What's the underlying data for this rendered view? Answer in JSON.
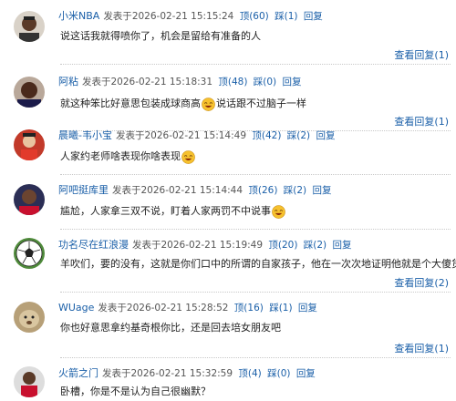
{
  "labels": {
    "posted_prefix": "发表于",
    "ding": "顶",
    "cai": "踩",
    "reply": "回复"
  },
  "comments": [
    {
      "user": "小米NBA",
      "time": "2026-02-21 15:15:24",
      "ding": "(60)",
      "cai": "(1)",
      "text": "说这话我就得喷你了，机会是留给有准备的人",
      "text_after": "",
      "emoji": "",
      "view_replies": "查看回复(1)",
      "avatar_icon": "player-photo-icon"
    },
    {
      "user": "阿粘",
      "time": "2026-02-21 15:18:31",
      "ding": "(48)",
      "cai": "(0)",
      "text": "就这种笨比好意思包装成球商高",
      "text_after": "说话跟不过脑子一样",
      "emoji": "laughing-face-icon",
      "view_replies": "查看回复(1)",
      "avatar_icon": "player-photo-icon"
    },
    {
      "user": "晨曦-韦小宝",
      "time": "2026-02-21 15:14:49",
      "ding": "(42)",
      "cai": "(2)",
      "text": "人家约老师啥表现你啥表现",
      "text_after": "",
      "emoji": "laughing-face-icon",
      "view_replies": "",
      "avatar_icon": "player-photo-icon"
    },
    {
      "user": "阿吧挺库里",
      "time": "2026-02-21 15:14:44",
      "ding": "(26)",
      "cai": "(2)",
      "text": "尴尬，人家拿三双不说，盯着人家两罚不中说事",
      "text_after": "",
      "emoji": "laughing-face-icon",
      "view_replies": "",
      "avatar_icon": "player-photo-icon"
    },
    {
      "user": "功名尽在红浪漫",
      "time": "2026-02-21 15:19:49",
      "ding": "(20)",
      "cai": "(2)",
      "text": "羊吹们，要的没有，这就是你们口中的所谓的自家孩子，他在一次次地证明他就是个大傻货",
      "text_after": "",
      "emoji": "",
      "view_replies": "查看回复(2)",
      "avatar_icon": "soccer-ball-icon"
    },
    {
      "user": "WUage",
      "time": "2026-02-21 15:28:52",
      "ding": "(16)",
      "cai": "(1)",
      "text": "你也好意思拿约基奇根你比，还是回去培女朋友吧",
      "text_after": "",
      "emoji": "",
      "view_replies": "查看回复(1)",
      "avatar_icon": "animal-photo-icon"
    },
    {
      "user": "火箭之门",
      "time": "2026-02-21 15:32:59",
      "ding": "(4)",
      "cai": "(0)",
      "text": "卧槽，你是不是认为自己很幽默？",
      "text_after": "",
      "emoji": "",
      "view_replies": "",
      "avatar_icon": "player-photo-icon"
    }
  ]
}
